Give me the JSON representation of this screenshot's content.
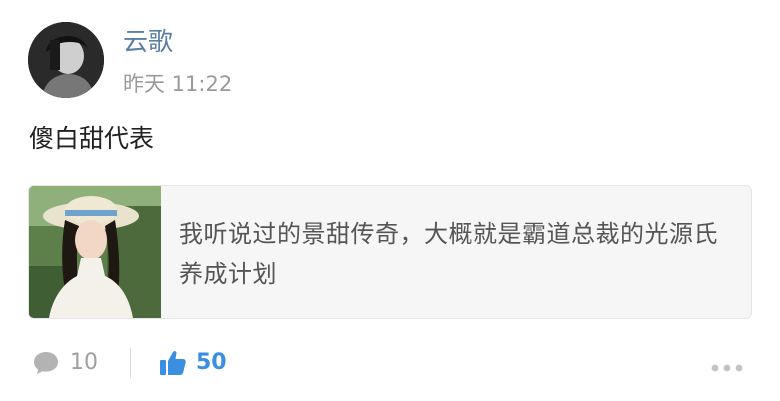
{
  "post": {
    "username": "云歌",
    "timestamp": "昨天 11:22",
    "text": "傻白甜代表"
  },
  "card": {
    "text": "我听说过的景甜传奇，大概就是霸道总裁的光源氏养成计划"
  },
  "actions": {
    "comment_count": "10",
    "like_count": "50",
    "colors": {
      "like": "#3b8fe0",
      "muted": "#a0a0a0"
    }
  },
  "icons": {
    "comment": "comment-bubble-icon",
    "like": "thumbs-up-icon",
    "more": "more-dots-icon"
  }
}
